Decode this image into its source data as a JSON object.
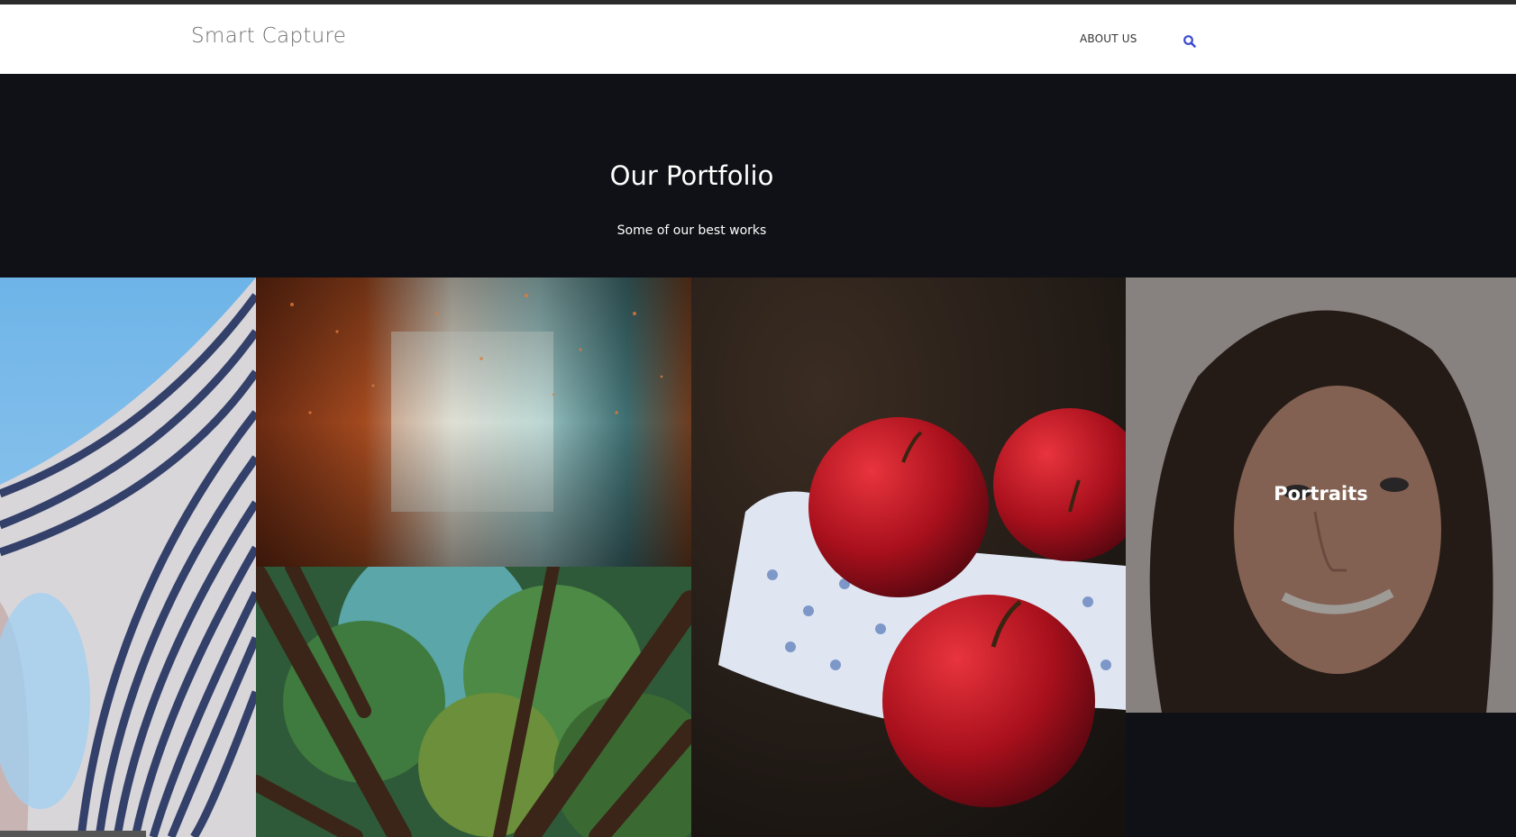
{
  "header": {
    "logo": "Smart Capture",
    "nav_about": "ABOUT US",
    "search_icon": "search-icon",
    "accent_color": "#3b4bd0"
  },
  "hero": {
    "title": "Our Portfolio",
    "subtitle": "Some of our best works"
  },
  "portfolio": {
    "portrait_label": "Portraits"
  }
}
